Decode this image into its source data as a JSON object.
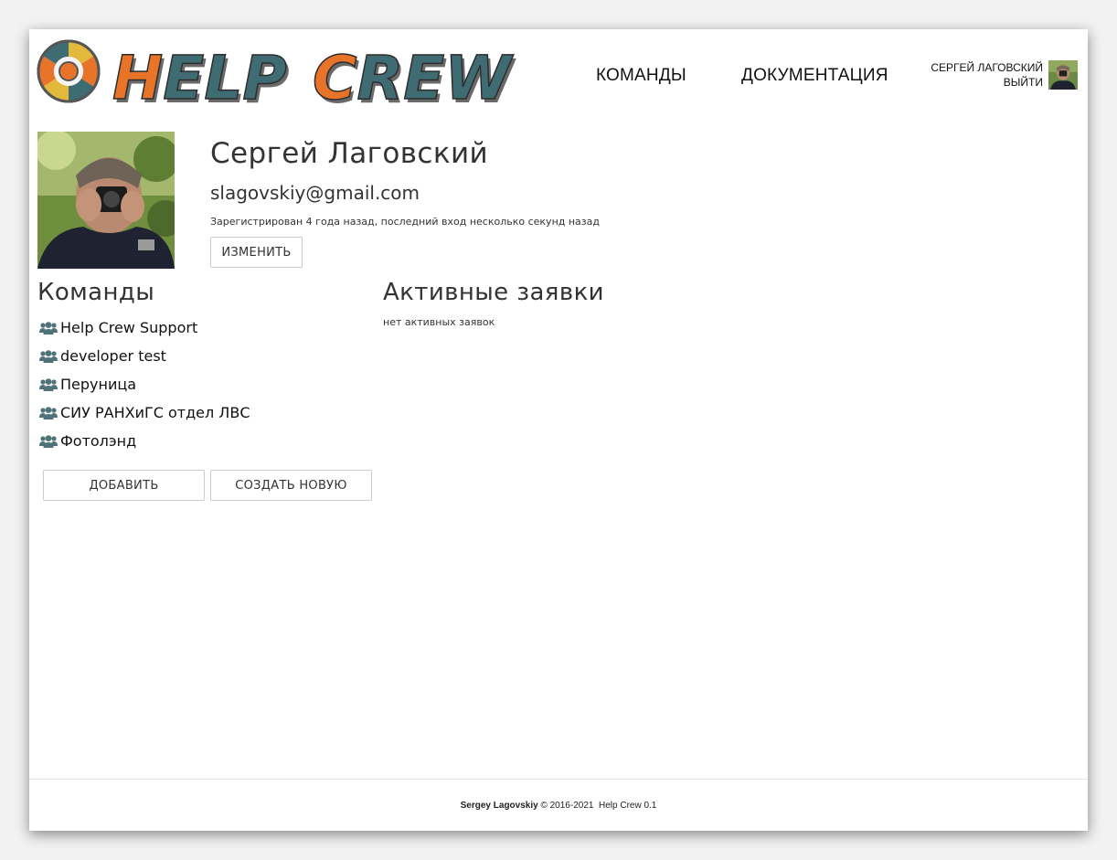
{
  "header": {
    "logo_text": "HELP CREW",
    "nav": [
      {
        "label": "КОМАНДЫ"
      },
      {
        "label": "ДОКУМЕНТАЦИЯ"
      }
    ],
    "user": {
      "name": "СЕРГЕЙ ЛАГОВСКИЙ",
      "logout": "ВЫЙТИ"
    }
  },
  "profile": {
    "name": "Сергей Лаговский",
    "email": "slagovskiy@gmail.com",
    "meta": "Зарегистрирован 4 года назад, последний вход несколько секунд назад",
    "edit_label": "ИЗМЕНИТЬ"
  },
  "teams": {
    "title": "Команды",
    "items": [
      {
        "label": "Help Crew Support",
        "icon": "users-icon"
      },
      {
        "label": "developer test",
        "icon": "users-icon"
      },
      {
        "label": "Перуница",
        "icon": "users-icon"
      },
      {
        "label": "СИУ РАНХиГС отдел ЛВС",
        "icon": "users-icon"
      },
      {
        "label": "Фотолэнд",
        "icon": "users-icon"
      }
    ],
    "add_label": "ДОБАВИТЬ",
    "create_label": "СОЗДАТЬ НОВУЮ"
  },
  "requests": {
    "title": "Активные заявки",
    "empty_text": "нет активных заявок"
  },
  "footer": {
    "author": "Sergey Lagovskiy",
    "copyright": "© 2016-2021",
    "app": "Help Crew 0.1"
  },
  "colors": {
    "logo_orange": "#e8742a",
    "logo_teal": "#3f6c73",
    "team_icon": "#4f7378"
  }
}
